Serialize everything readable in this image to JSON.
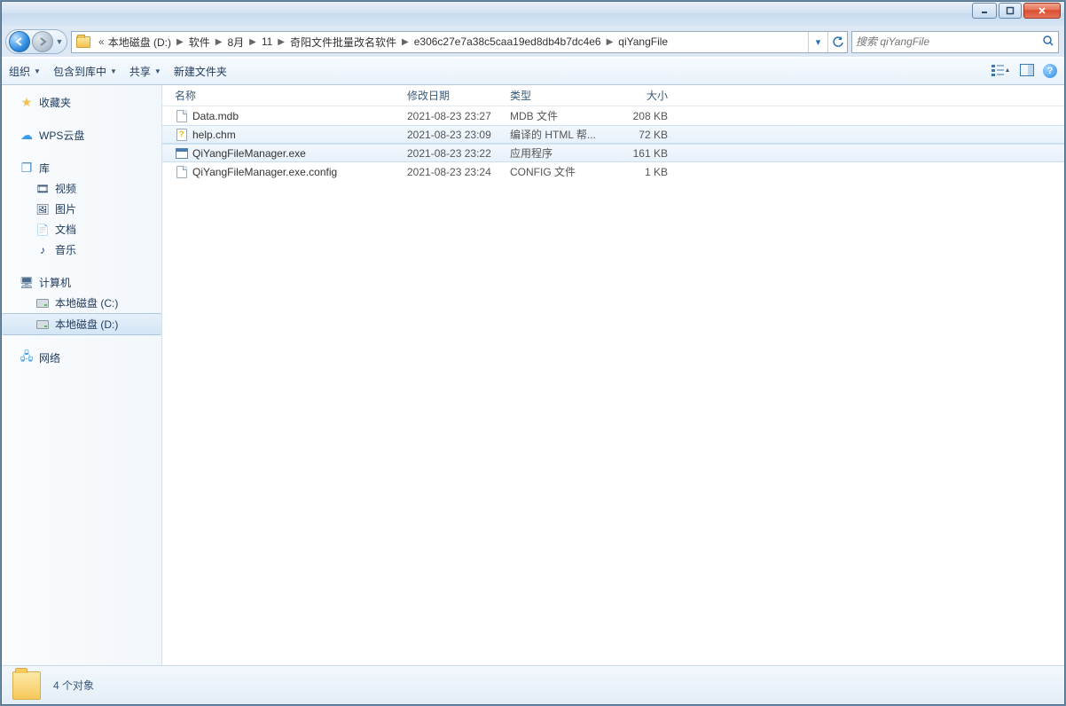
{
  "breadcrumbs": {
    "prefix": "«",
    "items": [
      "本地磁盘 (D:)",
      "软件",
      "8月",
      "11",
      "奇阳文件批量改名软件",
      "e306c27e7a38c5caa19ed8db4b7dc4e6",
      "qiYangFile"
    ]
  },
  "search": {
    "placeholder": "搜索 qiYangFile"
  },
  "toolbar": {
    "organize": "组织",
    "include": "包含到库中",
    "share": "共享",
    "new_folder": "新建文件夹"
  },
  "sidebar": {
    "favorites": "收藏夹",
    "wps": "WPS云盘",
    "libraries": "库",
    "lib_items": {
      "video": "视频",
      "pictures": "图片",
      "documents": "文档",
      "music": "音乐"
    },
    "computer": "计算机",
    "drive_c": "本地磁盘 (C:)",
    "drive_d": "本地磁盘 (D:)",
    "network": "网络"
  },
  "columns": {
    "name": "名称",
    "date": "修改日期",
    "type": "类型",
    "size": "大小"
  },
  "files": [
    {
      "name": "Data.mdb",
      "date": "2021-08-23 23:27",
      "type": "MDB 文件",
      "size": "208 KB",
      "icon": "doc"
    },
    {
      "name": "help.chm",
      "date": "2021-08-23 23:09",
      "type": "编译的 HTML 帮...",
      "size": "72 KB",
      "icon": "chm"
    },
    {
      "name": "QiYangFileManager.exe",
      "date": "2021-08-23 23:22",
      "type": "应用程序",
      "size": "161 KB",
      "icon": "exe"
    },
    {
      "name": "QiYangFileManager.exe.config",
      "date": "2021-08-23 23:24",
      "type": "CONFIG 文件",
      "size": "1 KB",
      "icon": "doc"
    }
  ],
  "status": {
    "count": "4 个对象"
  }
}
